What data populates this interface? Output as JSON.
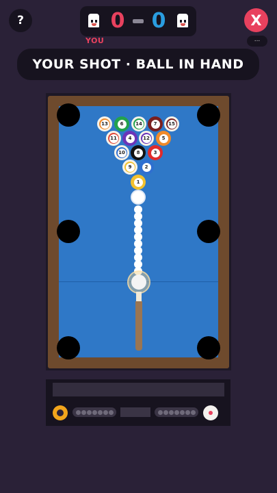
{
  "header": {
    "help_label": "?",
    "close_label": "X",
    "more_label": "...",
    "you_label": "YOU",
    "player_score": "0",
    "opponent_score": "0",
    "player_color": "#e8415e",
    "opponent_color": "#2a9de0"
  },
  "banner": {
    "text": "YOUR SHOT · BALL IN HAND"
  },
  "balls": [
    {
      "n": "13",
      "color": "#f08a2a",
      "stripe": true
    },
    {
      "n": "6",
      "color": "#23a24d",
      "stripe": false
    },
    {
      "n": "14",
      "color": "#23a24d",
      "stripe": true
    },
    {
      "n": "7",
      "color": "#7a1f1f",
      "stripe": false
    },
    {
      "n": "15",
      "color": "#7a1f1f",
      "stripe": true
    },
    {
      "n": "11",
      "color": "#e24b3b",
      "stripe": true
    },
    {
      "n": "4",
      "color": "#6b35b8",
      "stripe": false
    },
    {
      "n": "12",
      "color": "#6b35b8",
      "stripe": true
    },
    {
      "n": "5",
      "color": "#f08a2a",
      "stripe": false
    },
    {
      "n": "10",
      "color": "#2f6fd0",
      "stripe": true
    },
    {
      "n": "8",
      "color": "#111111",
      "stripe": false
    },
    {
      "n": "3",
      "color": "#e02b2b",
      "stripe": false
    },
    {
      "n": "9",
      "color": "#f2c12e",
      "stripe": true
    },
    {
      "n": "2",
      "color": "#2f6fd0",
      "stripe": false
    },
    {
      "n": "1",
      "color": "#f2c12e",
      "stripe": false
    }
  ],
  "colors": {
    "felt": "#2f78c7",
    "rail": "#6e4a2d",
    "player_badge": "#f2a51c",
    "opponent_badge": "#f4f1ee"
  }
}
